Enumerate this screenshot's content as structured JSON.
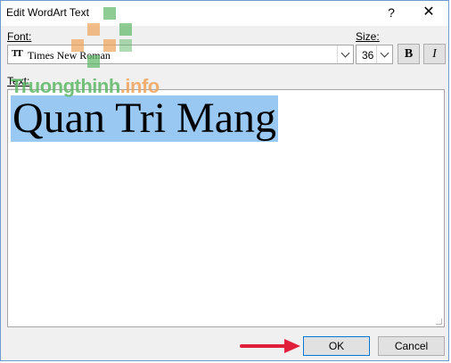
{
  "dialog": {
    "title": "Edit WordArt Text",
    "help_label": "?",
    "close_label": "✕"
  },
  "font": {
    "label": "Font:",
    "icon_glyph": "TT",
    "value": "Times New Roman"
  },
  "size": {
    "label": "Size:",
    "value": "36"
  },
  "format": {
    "bold_label": "B",
    "italic_label": "I"
  },
  "text": {
    "label": "Text:",
    "content": "Quan Tri Mang"
  },
  "buttons": {
    "ok_label": "OK",
    "cancel_label": "Cancel"
  },
  "watermark": {
    "part1": "Truongthinh",
    "part2": ".info"
  },
  "colors": {
    "selection": "#99c8f2",
    "arrow": "#e0203a",
    "ok_border": "#0078d7",
    "watermark_green": "#5db866",
    "watermark_orange": "#f0a35a"
  }
}
